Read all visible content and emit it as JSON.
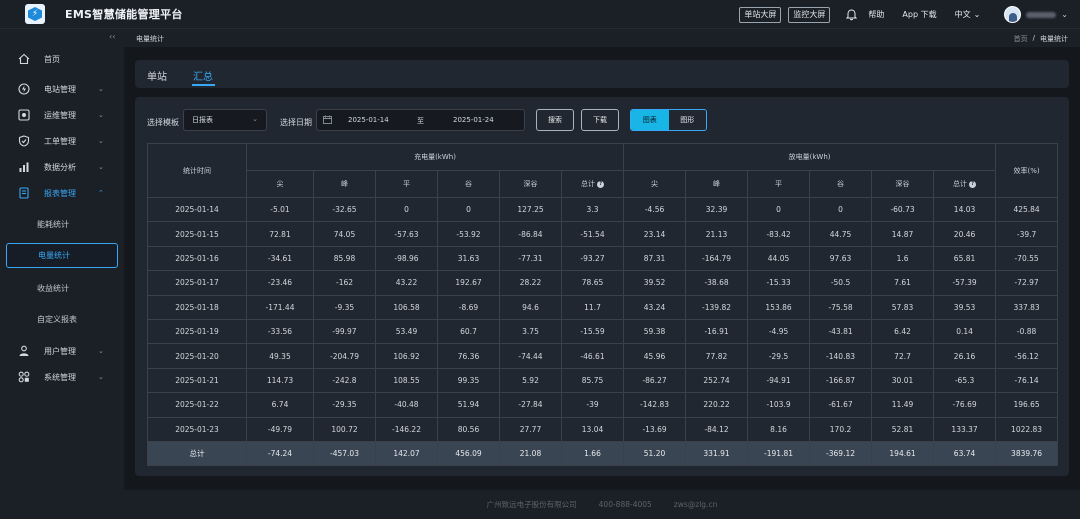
{
  "app": {
    "title": "EMS智慧储能管理平台"
  },
  "header": {
    "btn_single_screen": "单站大屏",
    "btn_monitor_screen": "监控大屏",
    "help": "帮助",
    "app_download": "App 下载",
    "language": "中文"
  },
  "sidebar": {
    "items": [
      {
        "label": "首页",
        "icon": "home-icon"
      },
      {
        "label": "电站管理",
        "icon": "power-station-icon"
      },
      {
        "label": "运维管理",
        "icon": "maintenance-icon"
      },
      {
        "label": "工单管理",
        "icon": "work-order-icon"
      },
      {
        "label": "数据分析",
        "icon": "bar-chart-icon"
      },
      {
        "label": "报表管理",
        "icon": "report-icon"
      },
      {
        "label": "用户管理",
        "icon": "user-icon"
      },
      {
        "label": "系统管理",
        "icon": "settings-grid-icon"
      }
    ],
    "sub_items": [
      "能耗统计",
      "电量统计",
      "收益统计",
      "自定义报表"
    ],
    "active_sub": "电量统计"
  },
  "breadcrumb": {
    "title": "电量统计",
    "home": "首页",
    "sep": "/",
    "current": "电量统计"
  },
  "tabs": [
    "单站",
    "汇总"
  ],
  "filters": {
    "template_label": "选择模板",
    "template_value": "日报表",
    "date_label": "选择日期",
    "date_start": "2025-01-14",
    "date_to": "至",
    "date_end": "2025-01-24",
    "search": "搜索",
    "download": "下载",
    "view_table": "图表",
    "view_graph": "图形"
  },
  "table": {
    "col_time": "统计时间",
    "group_charge": "充电量(kWh)",
    "group_discharge": "放电量(kWh)",
    "col_efficiency": "效率(%)",
    "sub_cols": [
      "尖",
      "峰",
      "平",
      "谷",
      "深谷",
      "总计"
    ],
    "rows": [
      [
        "2025-01-14",
        "-5.01",
        "-32.65",
        "0",
        "0",
        "127.25",
        "3.3",
        "-4.56",
        "32.39",
        "0",
        "0",
        "-60.73",
        "14.03",
        "425.84"
      ],
      [
        "2025-01-15",
        "72.81",
        "74.05",
        "-57.63",
        "-53.92",
        "-86.84",
        "-51.54",
        "23.14",
        "21.13",
        "-83.42",
        "44.75",
        "14.87",
        "20.46",
        "-39.7"
      ],
      [
        "2025-01-16",
        "-34.61",
        "85.98",
        "-98.96",
        "31.63",
        "-77.31",
        "-93.27",
        "87.31",
        "-164.79",
        "44.05",
        "97.63",
        "1.6",
        "65.81",
        "-70.55"
      ],
      [
        "2025-01-17",
        "-23.46",
        "-162",
        "43.22",
        "192.67",
        "28.22",
        "78.65",
        "39.52",
        "-38.68",
        "-15.33",
        "-50.5",
        "7.61",
        "-57.39",
        "-72.97"
      ],
      [
        "2025-01-18",
        "-171.44",
        "-9.35",
        "106.58",
        "-8.69",
        "94.6",
        "11.7",
        "43.24",
        "-139.82",
        "153.86",
        "-75.58",
        "57.83",
        "39.53",
        "337.83"
      ],
      [
        "2025-01-19",
        "-33.56",
        "-99.97",
        "53.49",
        "60.7",
        "3.75",
        "-15.59",
        "59.38",
        "-16.91",
        "-4.95",
        "-43.81",
        "6.42",
        "0.14",
        "-0.88"
      ],
      [
        "2025-01-20",
        "49.35",
        "-204.79",
        "106.92",
        "76.36",
        "-74.44",
        "-46.61",
        "45.96",
        "77.82",
        "-29.5",
        "-140.83",
        "72.7",
        "26.16",
        "-56.12"
      ],
      [
        "2025-01-21",
        "114.73",
        "-242.8",
        "108.55",
        "99.35",
        "5.92",
        "85.75",
        "-86.27",
        "252.74",
        "-94.91",
        "-166.87",
        "30.01",
        "-65.3",
        "-76.14"
      ],
      [
        "2025-01-22",
        "6.74",
        "-29.35",
        "-40.48",
        "51.94",
        "-27.84",
        "-39",
        "-142.83",
        "220.22",
        "-103.9",
        "-61.67",
        "11.49",
        "-76.69",
        "196.65"
      ],
      [
        "2025-01-23",
        "-49.79",
        "100.72",
        "-146.22",
        "80.56",
        "27.77",
        "13.04",
        "-13.69",
        "-84.12",
        "8.16",
        "170.2",
        "52.81",
        "133.37",
        "1022.83"
      ]
    ],
    "total": [
      "总计",
      "-74.24",
      "-457.03",
      "142.07",
      "456.09",
      "21.08",
      "1.66",
      "51.20",
      "331.91",
      "-191.81",
      "-369.12",
      "194.61",
      "63.74",
      "3839.76"
    ]
  },
  "footer": {
    "company": "广州致远电子股份有限公司",
    "phone": "400-888-4005",
    "email": "zws@zlg.cn"
  }
}
